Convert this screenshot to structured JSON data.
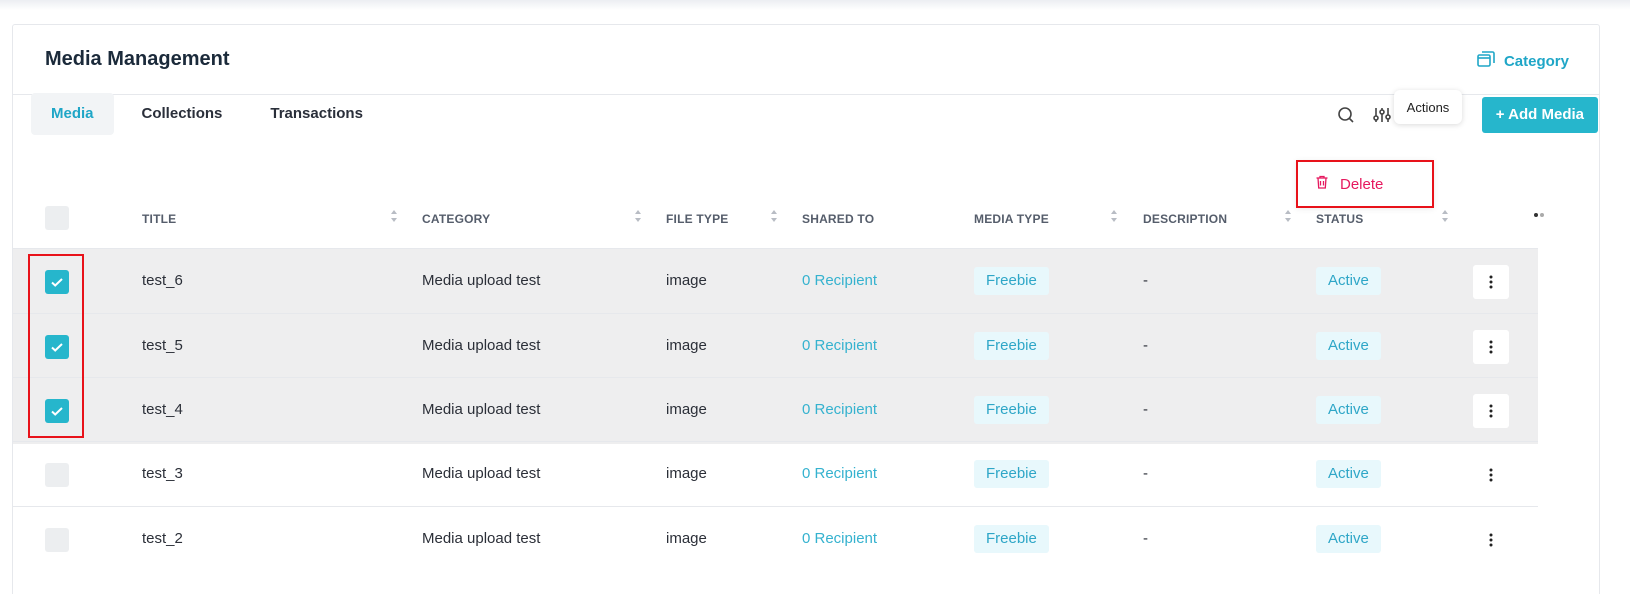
{
  "header": {
    "title": "Media Management",
    "category_link": "Category"
  },
  "tabs": [
    {
      "label": "Media",
      "active": true
    },
    {
      "label": "Collections",
      "active": false
    },
    {
      "label": "Transactions",
      "active": false
    }
  ],
  "toolbar": {
    "icons": [
      "search-icon",
      "filter-sliders-icon",
      "export-document-icon",
      "kebab-actions-icon"
    ],
    "add_label": "+ Add Media",
    "tooltip": "Actions",
    "dropdown_delete": "Delete"
  },
  "table": {
    "columns": [
      "TITLE",
      "CATEGORY",
      "FILE TYPE",
      "SHARED TO",
      "MEDIA TYPE",
      "DESCRIPTION",
      "STATUS"
    ],
    "rows": [
      {
        "title": "test_6",
        "category": "Media upload test",
        "file_type": "image",
        "shared_to": "0 Recipient",
        "media_type": "Freebie",
        "description": "-",
        "status": "Active",
        "selected": true
      },
      {
        "title": "test_5",
        "category": "Media upload test",
        "file_type": "image",
        "shared_to": "0 Recipient",
        "media_type": "Freebie",
        "description": "-",
        "status": "Active",
        "selected": true
      },
      {
        "title": "test_4",
        "category": "Media upload test",
        "file_type": "image",
        "shared_to": "0 Recipient",
        "media_type": "Freebie",
        "description": "-",
        "status": "Active",
        "selected": true
      },
      {
        "title": "test_3",
        "category": "Media upload test",
        "file_type": "image",
        "shared_to": "0 Recipient",
        "media_type": "Freebie",
        "description": "-",
        "status": "Active",
        "selected": false
      },
      {
        "title": "test_2",
        "category": "Media upload test",
        "file_type": "image",
        "shared_to": "0 Recipient",
        "media_type": "Freebie",
        "description": "-",
        "status": "Active",
        "selected": false
      }
    ]
  },
  "colors": {
    "accent": "#26b6cc",
    "link": "#1fa6c7",
    "danger": "#e6195f",
    "highlight": "#e8121a"
  }
}
